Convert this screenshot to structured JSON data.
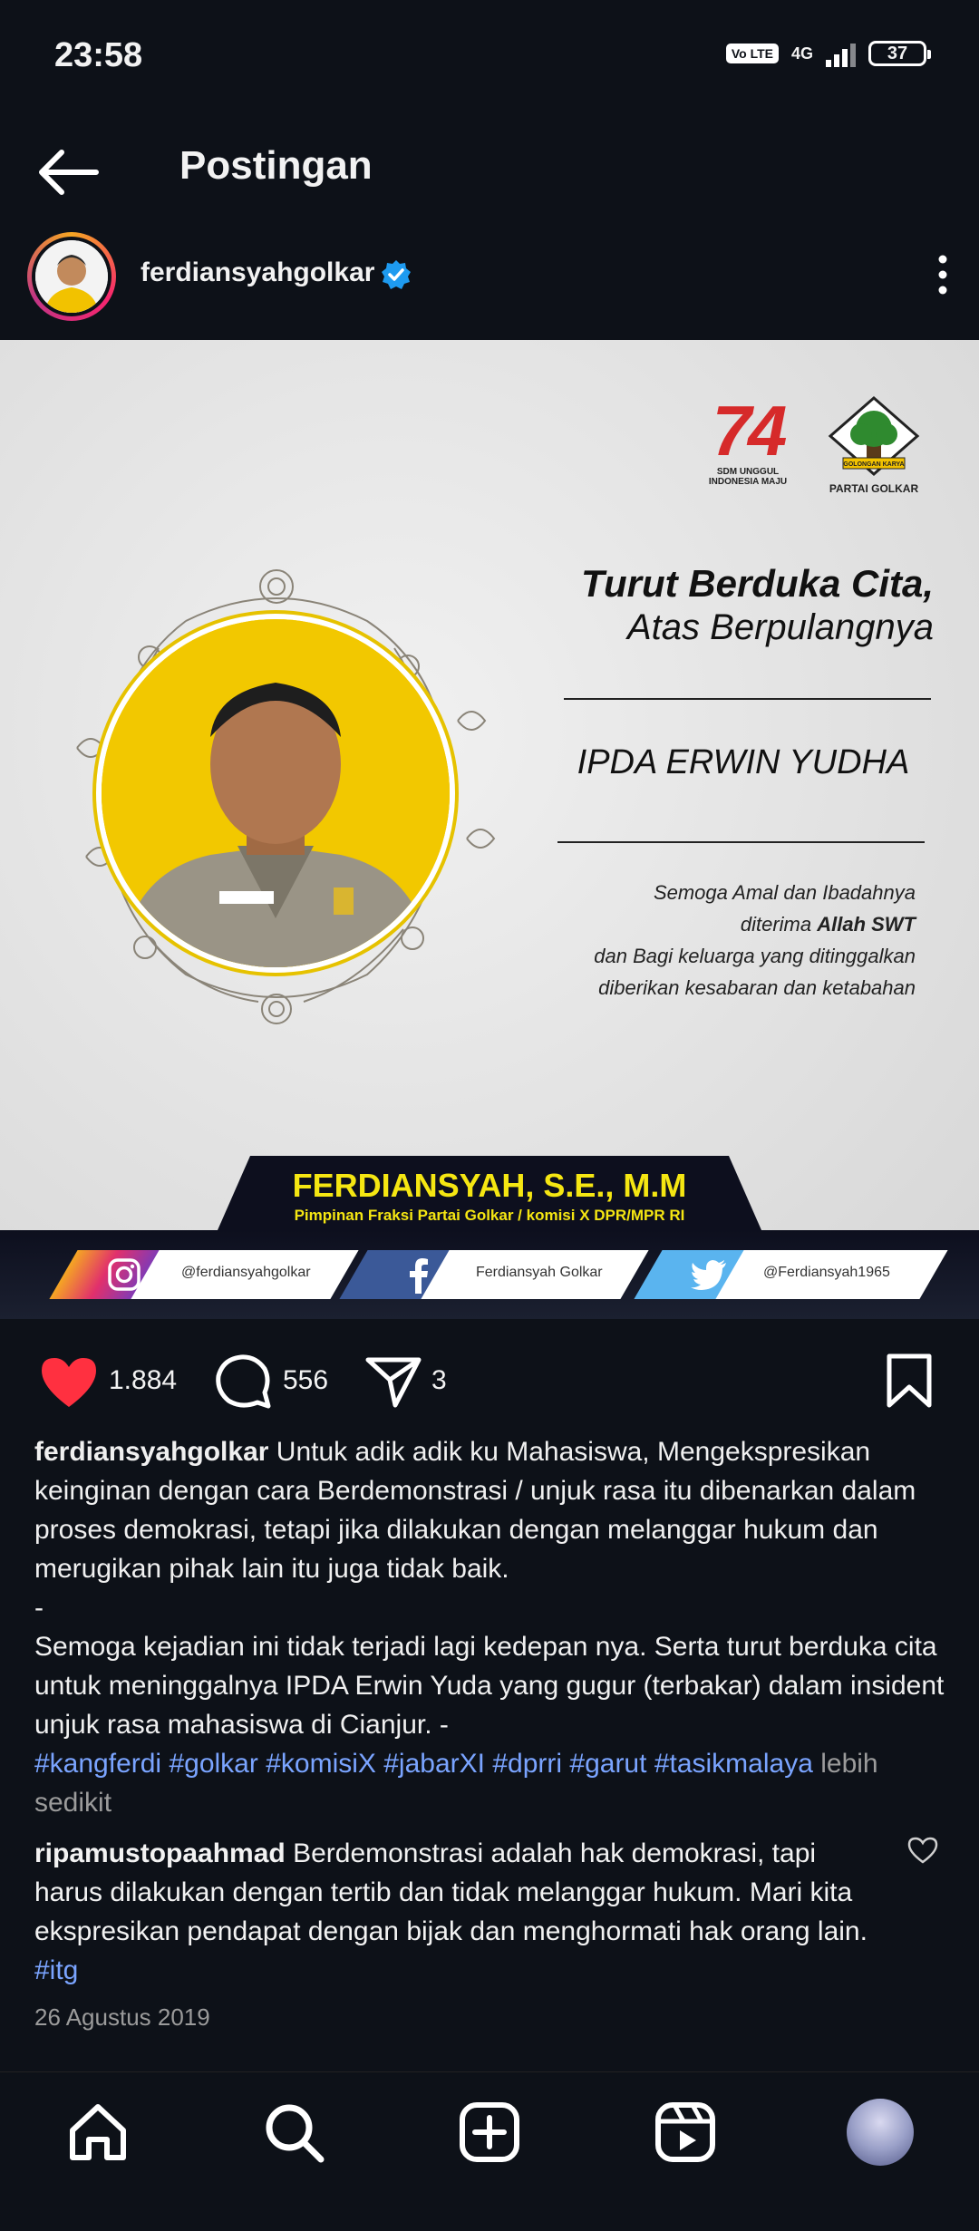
{
  "status_bar": {
    "time": "23:58",
    "volte": "Vo LTE",
    "network": "4G",
    "battery": "37"
  },
  "header": {
    "title": "Postingan"
  },
  "author": {
    "username": "ferdiansyahgolkar",
    "verified": true
  },
  "post_image": {
    "anniversary_number": "74",
    "anniversary_caption_1": "SDM UNGGUL",
    "anniversary_caption_2": "INDONESIA MAJU",
    "party_banner": "GOLONGAN KARYA",
    "party_name": "PARTAI GOLKAR",
    "condolence_line1": "Turut Berduka Cita,",
    "condolence_line2": "Atas Berpulangnya",
    "deceased_name": "IPDA ERWIN YUDHA",
    "prayer_1": "Semoga Amal dan Ibadahnya",
    "prayer_2a": "diterima ",
    "prayer_2b": "Allah SWT",
    "prayer_3": "dan Bagi keluarga yang ditinggalkan",
    "prayer_4": "diberikan kesabaran dan ketabahan",
    "sender_name": "FERDIANSYAH, S.E., M.M",
    "sender_role": "Pimpinan Fraksi Partai Golkar / komisi X DPR/MPR RI",
    "social_instagram": "@ferdiansyahgolkar",
    "social_facebook": "Ferdiansyah Golkar",
    "social_twitter": "@Ferdiansyah1965"
  },
  "actions": {
    "likes": "1.884",
    "comments": "556",
    "shares": "3"
  },
  "caption": {
    "username": "ferdiansyahgolkar",
    "text_1": " Untuk adik adik ku Mahasiswa, Mengekspresikan keinginan dengan cara Berdemonstrasi / unjuk rasa itu dibenarkan dalam proses demokrasi, tetapi jika dilakukan dengan melanggar hukum dan merugikan pihak lain itu juga tidak baik.",
    "separator": "-",
    "text_2": "Semoga kejadian ini tidak terjadi lagi kedepan nya. Serta turut berduka cita untuk meninggalnya IPDA Erwin Yuda yang gugur (terbakar) dalam insident unjuk rasa mahasiswa di Cianjur. -",
    "hashtags": [
      "#kangferdi",
      "#golkar",
      "#komisiX",
      "#jabarXI",
      "#dprri",
      "#garut",
      "#tasikmalaya"
    ],
    "more": " lebih sedikit"
  },
  "comment": {
    "username": "ripamustopaahmad",
    "text": " Berdemonstrasi adalah hak demokrasi, tapi harus dilakukan dengan tertib dan tidak melanggar hukum. Mari kita ekspresikan pendapat dengan bijak dan menghormati hak orang lain. ",
    "hashtag": "#itg"
  },
  "post_date": "26 Agustus 2019",
  "colors": {
    "background": "#0d1118",
    "like_red": "#ff3040",
    "link_blue": "#7aa4ff",
    "verified_blue": "#1e9bf0",
    "banner_yellow": "#f5e612"
  },
  "icons": {
    "back": "arrow-left-icon",
    "more": "more-vertical-icon",
    "like": "heart-filled-icon",
    "comment": "comment-icon",
    "share": "paper-plane-icon",
    "save": "bookmark-icon",
    "nav": [
      "home-icon",
      "search-icon",
      "create-icon",
      "reels-icon",
      "profile-avatar"
    ]
  }
}
